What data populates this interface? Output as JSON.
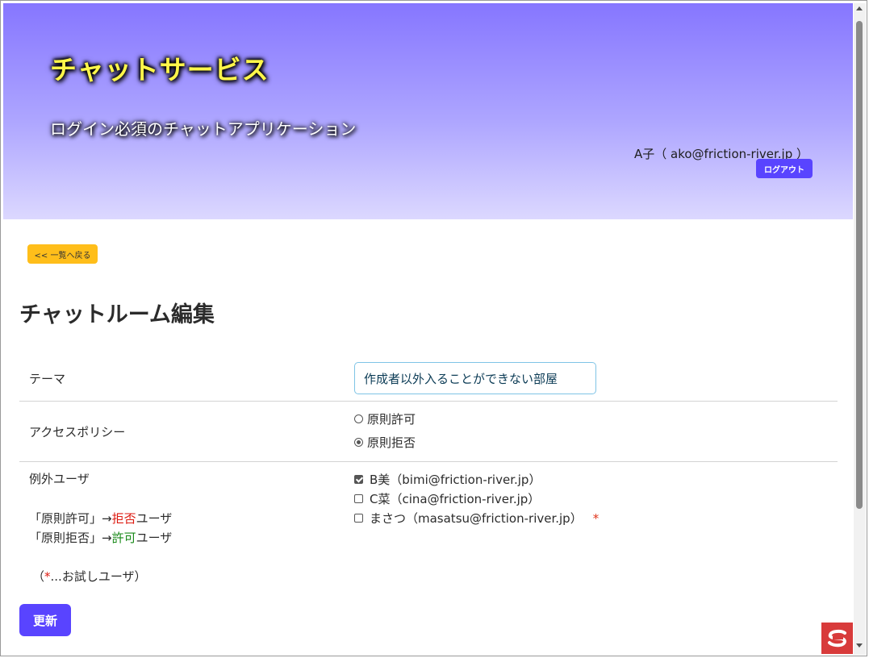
{
  "header": {
    "title": "チャットサービス",
    "subtitle": "ログイン必須のチャットアプリケーション",
    "user_info": "A子（ ako@friction-river.jp ）",
    "logout_label": "ログアウト"
  },
  "nav": {
    "back_label": "<< 一覧へ戻る"
  },
  "page": {
    "title": "チャットルーム編集"
  },
  "form": {
    "theme_label": "テーマ",
    "theme_value": "作成者以外入ることができない部屋",
    "access_label": "アクセスポリシー",
    "access_options": [
      {
        "label": "原則許可",
        "checked": false
      },
      {
        "label": "原則拒否",
        "checked": true
      }
    ],
    "exception_label": "例外ユーザ",
    "help_allow_prefix": "「原則許可」→",
    "help_allow_word": "拒否",
    "help_allow_suffix": "ユーザ",
    "help_deny_prefix": "「原則拒否」→",
    "help_deny_word": "許可",
    "help_deny_suffix": "ユーザ",
    "trial_open": "（",
    "trial_star": "*",
    "trial_text": "...お試しユーザ）",
    "users": [
      {
        "label": "B美（bimi@friction-river.jp）",
        "checked": true
      },
      {
        "label": "C菜（cina@friction-river.jp）",
        "checked": false
      },
      {
        "label": "まさつ（masatsu@friction-river.jp）",
        "checked": false,
        "mark": "*"
      }
    ],
    "submit_label": "更新"
  },
  "colors": {
    "accent": "#5944ff",
    "back_button": "#ffbe1a",
    "title_yellow": "#fff64a",
    "deny_red": "#dd1a10",
    "allow_green": "#1a8a1a"
  },
  "icons": {
    "corner_logo": "s-logo-icon"
  }
}
